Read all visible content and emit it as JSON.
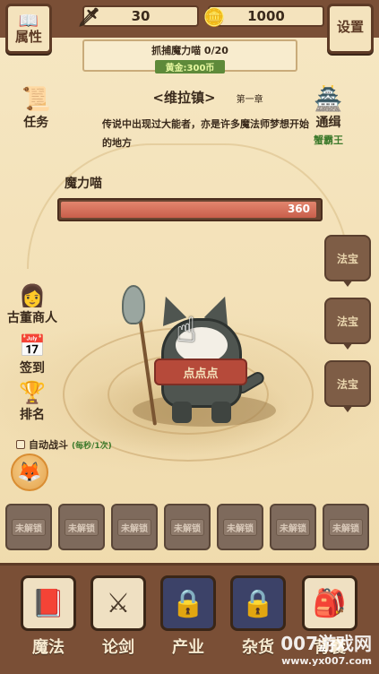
{
  "top": {
    "attribute_label": "属性",
    "settings_label": "设置",
    "swords_count": "30",
    "coins_count": "1000"
  },
  "quest": {
    "title": "抓捕魔力喵 0/20",
    "reward": "黄金:300币"
  },
  "task_label": "任务",
  "bounty": {
    "label": "通缉",
    "sub": "蟹霸王"
  },
  "location": {
    "title": "<维拉镇>",
    "chapter": "第一章",
    "desc": "传说中出现过大能者，亦是许多魔法师梦想开始的地方"
  },
  "monster": {
    "name": "魔力喵",
    "hp": "360",
    "hp_fraction": 0.99
  },
  "treasure_buttons": [
    "法宝",
    "法宝",
    "法宝"
  ],
  "left_menu": [
    "古董商人",
    "签到",
    "排名"
  ],
  "auto_battle": {
    "label": "自动战斗",
    "note": "(每秒/1次)"
  },
  "scarf_text": "点点点",
  "locked_slots": [
    "未解锁",
    "未解锁",
    "未解锁",
    "未解锁",
    "未解锁",
    "未解锁",
    "未解锁"
  ],
  "bottom_nav": [
    "魔法",
    "论剑",
    "产业",
    "杂货",
    "背囊"
  ],
  "watermark": {
    "big": "007游戏网",
    "small": "www.yx007.com"
  },
  "colors": {
    "frame": "#7a4f36",
    "hp_fill": "#c95f4b",
    "reward_green": "#5e8a3a"
  }
}
